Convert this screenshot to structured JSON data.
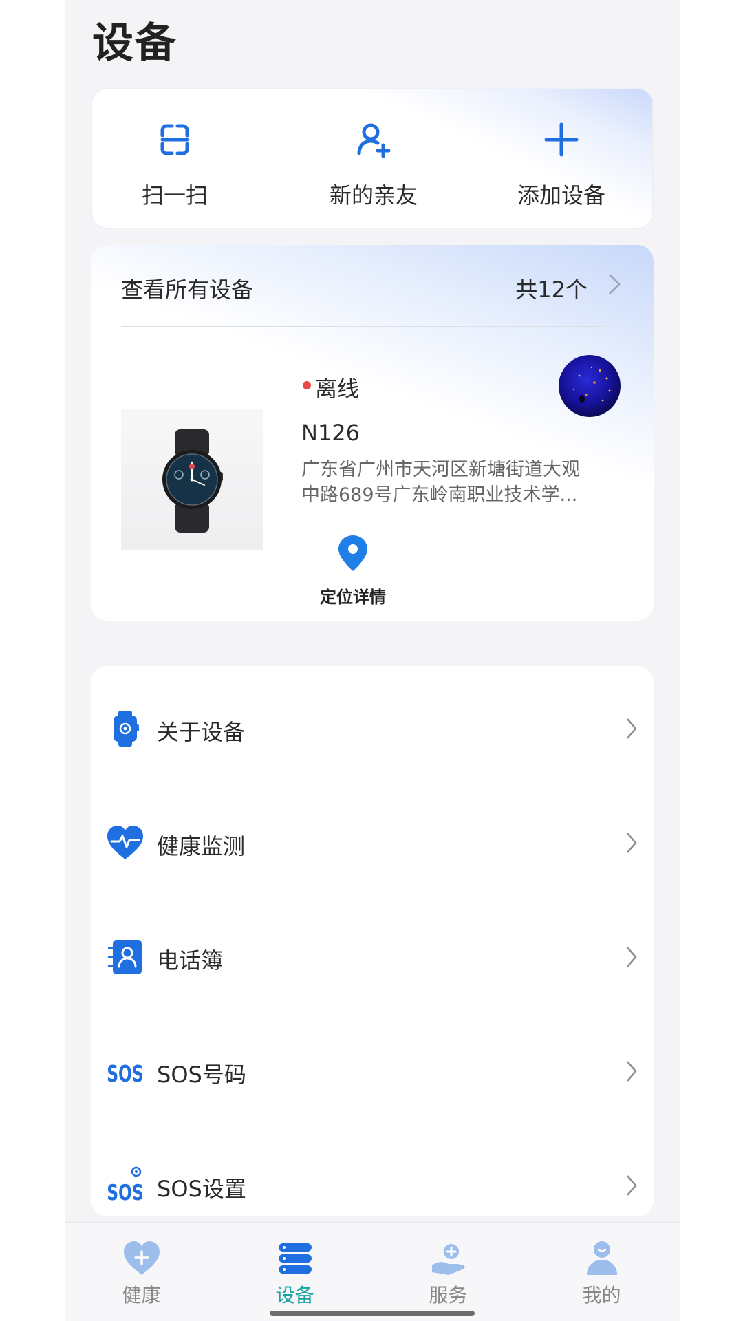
{
  "page": {
    "title": "设备"
  },
  "quick_actions": [
    {
      "label": "扫一扫",
      "icon": "scan-icon"
    },
    {
      "label": "新的亲友",
      "icon": "add-friend-icon"
    },
    {
      "label": "添加设备",
      "icon": "plus-icon"
    }
  ],
  "device_card": {
    "all_devices_label": "查看所有设备",
    "count_label": "共12个",
    "status": "离线",
    "status_color": "#e84a4a",
    "device_name": "N126",
    "address": "广东省广州市天河区新塘街道大观中路689号广东岭南职业技术学...",
    "locate_label": "定位详情"
  },
  "menu": [
    {
      "label": "关于设备",
      "icon": "watch-icon"
    },
    {
      "label": "健康监测",
      "icon": "heart-pulse-icon"
    },
    {
      "label": "电话簿",
      "icon": "contacts-book-icon"
    },
    {
      "label": "SOS号码",
      "icon": "sos-icon"
    },
    {
      "label": "SOS设置",
      "icon": "sos-settings-icon"
    }
  ],
  "tabbar": {
    "items": [
      {
        "label": "健康",
        "icon": "heart-plus-icon",
        "active": false
      },
      {
        "label": "设备",
        "icon": "device-stack-icon",
        "active": true
      },
      {
        "label": "服务",
        "icon": "service-hand-icon",
        "active": false
      },
      {
        "label": "我的",
        "icon": "person-icon",
        "active": false
      }
    ],
    "active_color": "#1aa3a3",
    "inactive_color": "#888888"
  },
  "colors": {
    "accent_blue": "#1f6fe0",
    "background": "#f4f4f6"
  }
}
